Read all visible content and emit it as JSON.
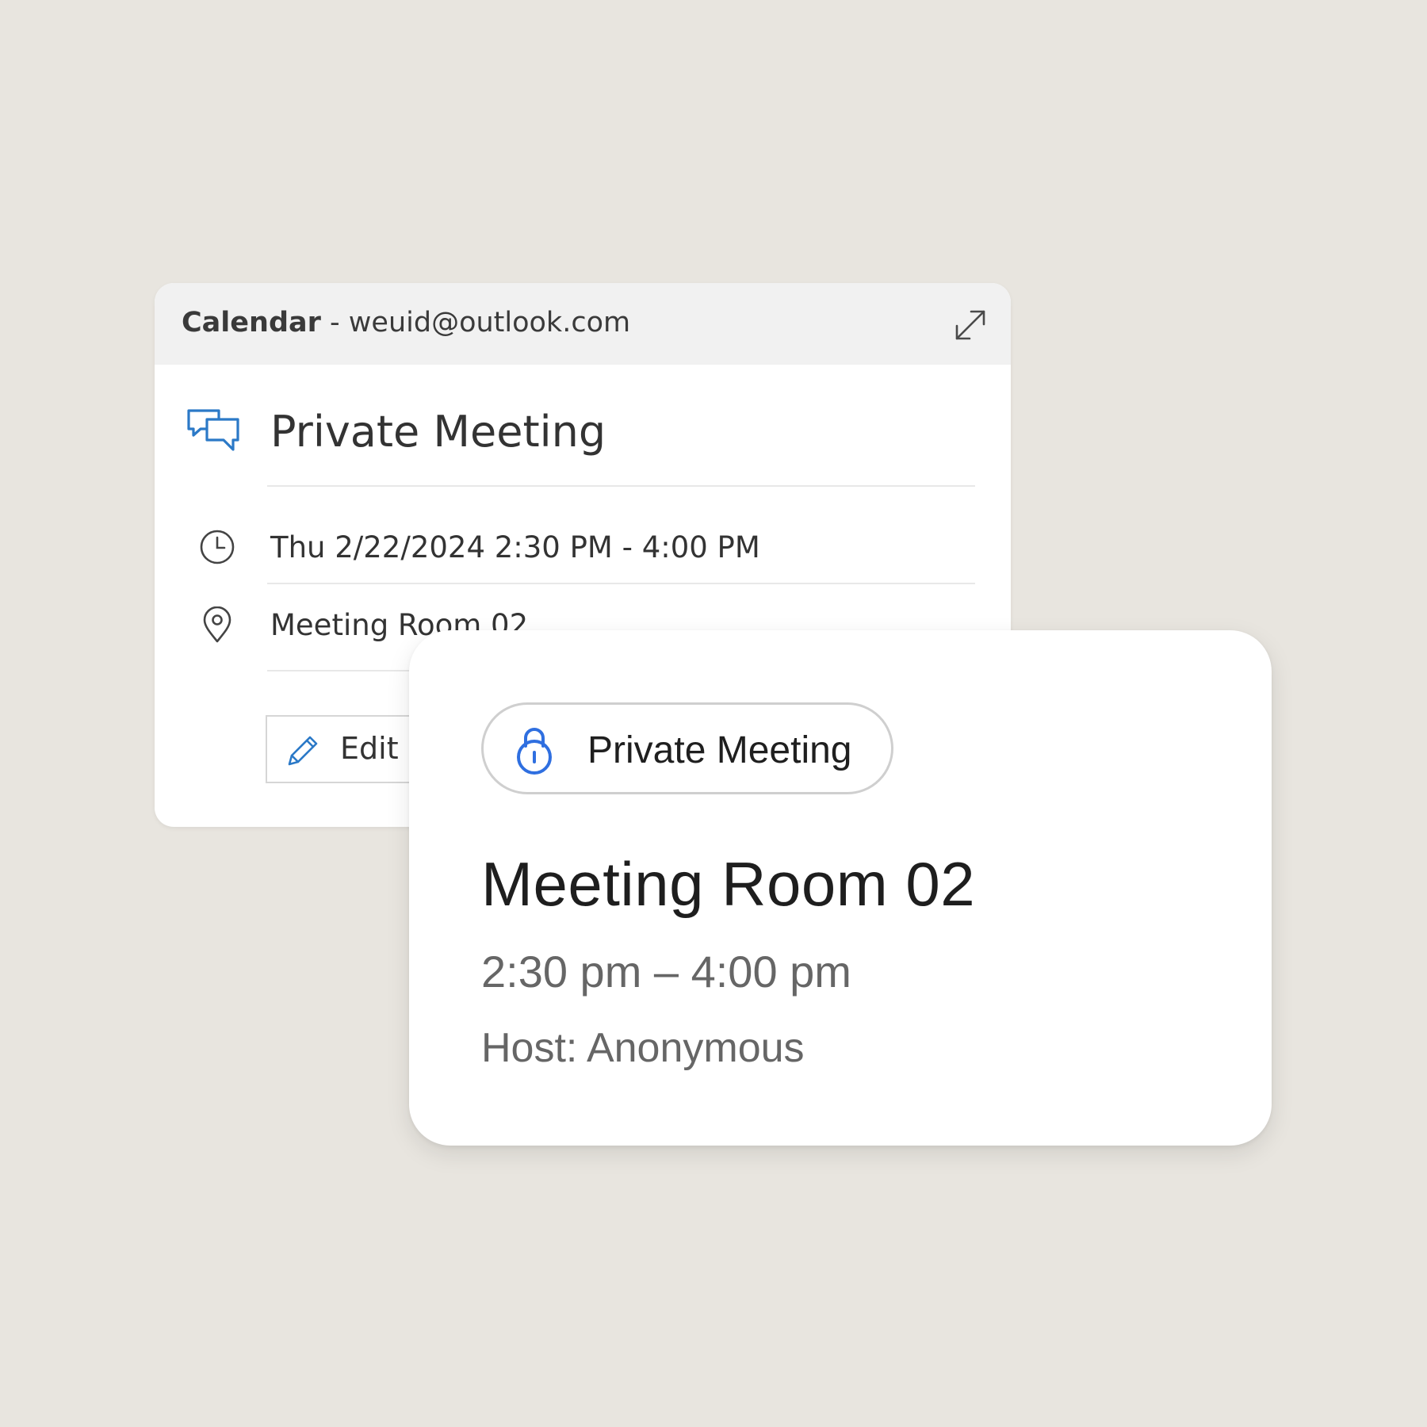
{
  "calendar_card": {
    "header": {
      "app_name": "Calendar",
      "separator": " - ",
      "account": "weuid@outlook.com"
    },
    "event_title": "Private Meeting",
    "datetime": "Thu 2/22/2024 2:30 PM - 4:00 PM",
    "location": "Meeting Room 02",
    "edit_label": "Edit"
  },
  "room_card": {
    "badge_label": "Private Meeting",
    "room_name": "Meeting Room 02",
    "time_range": "2:30 pm – 4:00 pm",
    "host": "Host: Anonymous"
  },
  "icons": {
    "expand": "expand-arrows-icon",
    "meeting": "chat-bubbles-icon",
    "clock": "clock-icon",
    "location": "map-pin-icon",
    "edit": "pencil-icon",
    "lock": "lock-icon"
  },
  "colors": {
    "background": "#e8e5df",
    "outlook_blue": "#2b79c7",
    "lock_blue": "#2f6fe0"
  }
}
